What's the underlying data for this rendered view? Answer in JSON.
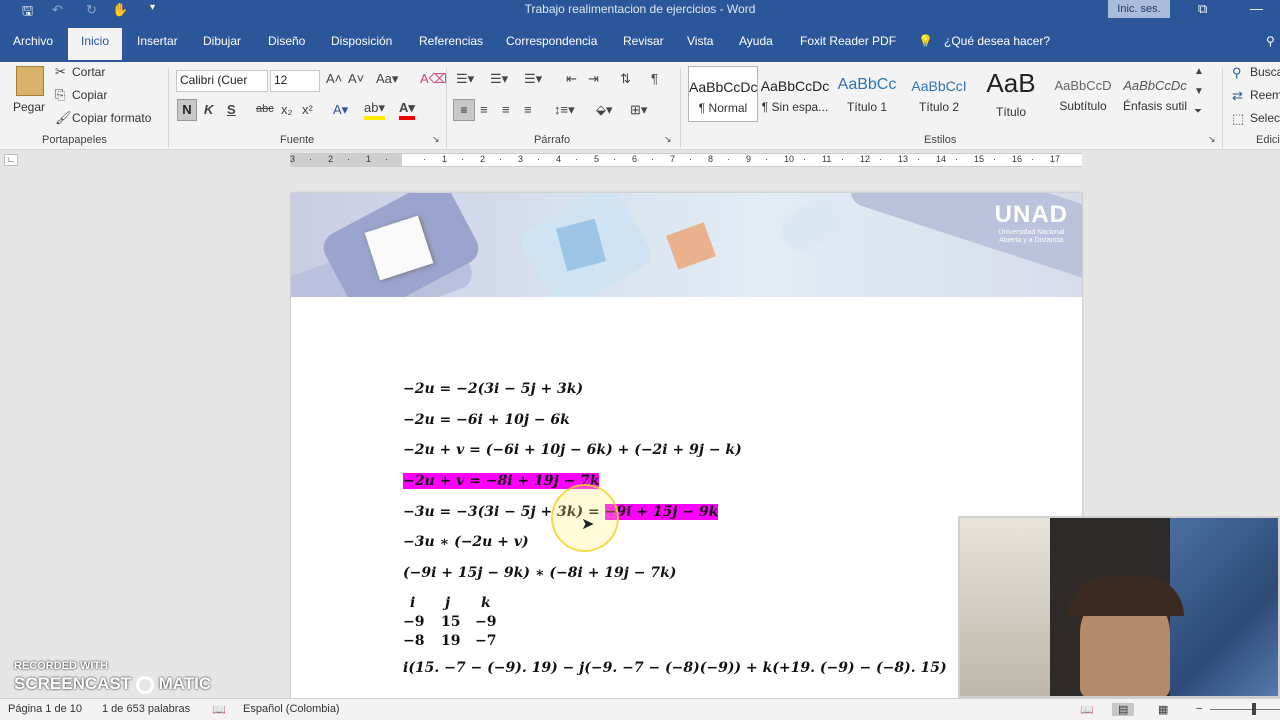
{
  "window": {
    "title": "Trabajo realimentacion de ejercicios  -  Word",
    "signin": "Inic. ses."
  },
  "tabs": [
    "Archivo",
    "Inicio",
    "Insertar",
    "Dibujar",
    "Diseño",
    "Disposición",
    "Referencias",
    "Correspondencia",
    "Revisar",
    "Vista",
    "Ayuda",
    "Foxit Reader PDF"
  ],
  "tell_me": "¿Qué desea hacer?",
  "clipboard": {
    "paste": "Pegar",
    "cut": "Cortar",
    "copy": "Copiar",
    "format": "Copiar formato",
    "label": "Portapapeles"
  },
  "font": {
    "name": "Calibri (Cuer",
    "size": "12",
    "label": "Fuente",
    "bold": "N",
    "italic": "K",
    "underline": "S",
    "strike": "abc"
  },
  "paragraph": {
    "label": "Párrafo"
  },
  "styles": {
    "label": "Estilos",
    "items": [
      {
        "preview": "AaBbCcDc",
        "name": "¶ Normal"
      },
      {
        "preview": "AaBbCcDc",
        "name": "¶ Sin espa..."
      },
      {
        "preview": "AaBbCc",
        "name": "Título 1"
      },
      {
        "preview": "AaBbCcI",
        "name": "Título 2"
      },
      {
        "preview": "AaB",
        "name": "Título"
      },
      {
        "preview": "AaBbCcD",
        "name": "Subtítulo"
      },
      {
        "preview": "AaBbCcDc",
        "name": "Énfasis sutil"
      }
    ]
  },
  "editing": {
    "find": "Busca",
    "replace": "Reem",
    "select": "Selec",
    "label": "Edici"
  },
  "logo": {
    "brand": "UNAD",
    "sub1": "Universidad Nacional",
    "sub2": "Abierta y a Distancia"
  },
  "equations": [
    "−2u = −2(3i − 5j + 3k)",
    "−2u = −6i + 10j − 6k",
    "−2u + v = (−6i + 10j − 6k) + (−2i + 9j − k)",
    "−2u + v = −8i + 19j − 7k",
    "−3u = −3(3i − 5j + 3k) = ",
    "−3u ∗ (−2u + v)",
    "(−9i + 15j − 9k) ∗ (−8i + 19j − 7k)",
    "i(15. −7 − (−9). 19) − j(−9. −7 − (−8)(−9)) + k(+19. (−9) − (−8). 15)"
  ],
  "eq_highlight": "−9i + 15j − 9k",
  "matrix": [
    [
      "i",
      "j",
      "k"
    ],
    [
      "−9",
      "15",
      "−9"
    ],
    [
      "−8",
      "19",
      "−7"
    ]
  ],
  "status": {
    "page": "Página 1 de 10",
    "words": "1 de 653 palabras",
    "language": "Español (Colombia)"
  },
  "watermark": {
    "line1": "RECORDED WITH",
    "line2": "SCREENCAST",
    "line3": "MATIC"
  }
}
